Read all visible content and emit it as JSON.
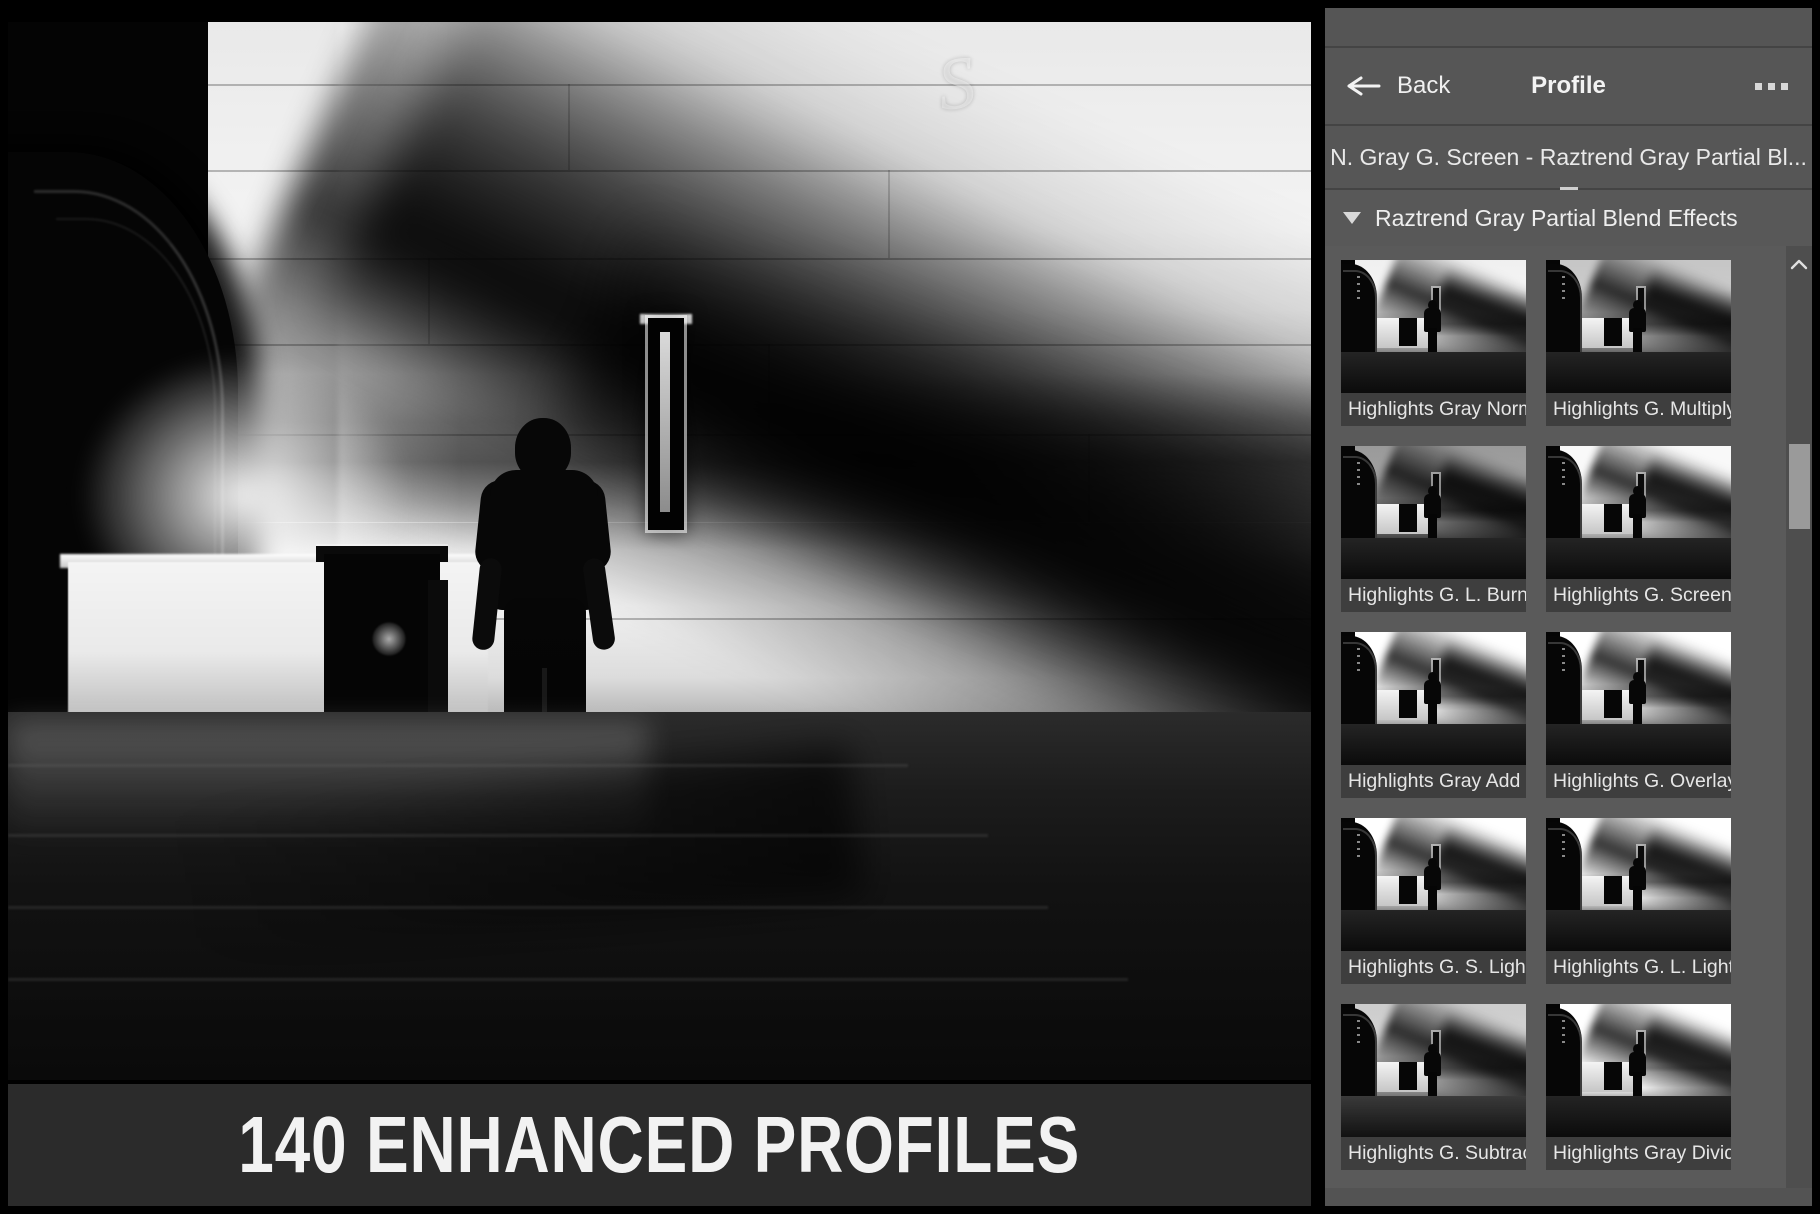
{
  "banner": {
    "text": "140 ENHANCED PROFILES"
  },
  "photo": {
    "alt": "Black and white photograph of a man walking through a stone passageway with strong diagonal shadows",
    "script_mark": "S"
  },
  "panel": {
    "header": {
      "back_label": "Back",
      "title": "Profile",
      "back_icon": "arrow-left-icon",
      "overflow_icon": "ellipsis-icon"
    },
    "current_profile": "N. Gray G. Screen - Raztrend Gray Partial Bl...",
    "group": {
      "label": "Raztrend Gray Partial Blend Effects",
      "caret_icon": "caret-down-icon",
      "expanded": true
    },
    "scrollbar": {
      "up_icon": "chevron-up-icon",
      "thumb_top_pct": 21,
      "thumb_height_pct": 9
    },
    "thumbnails": [
      {
        "label": "Highlights Gray Normal",
        "variant": "v-normal"
      },
      {
        "label": "Highlights G. Multiply",
        "variant": "v-multiply"
      },
      {
        "label": "Highlights G. L. Burn",
        "variant": "v-lburn"
      },
      {
        "label": "Highlights G. Screen",
        "variant": "v-screen"
      },
      {
        "label": "Highlights Gray Add",
        "variant": "v-add"
      },
      {
        "label": "Highlights G. Overlay",
        "variant": "v-overlay"
      },
      {
        "label": "Highlights G. S. Light",
        "variant": "v-slight"
      },
      {
        "label": "Highlights G. L. Light",
        "variant": "v-llight"
      },
      {
        "label": "Highlights G. Subtract",
        "variant": "v-subtract"
      },
      {
        "label": "Highlights Gray Divide",
        "variant": "v-divide"
      }
    ]
  },
  "colors": {
    "panel_bg": "#535353",
    "grid_bg": "#5a5a5a",
    "caption_bg": "#3e3e3e",
    "banner_bg": "#2b2b2b",
    "text": "#eeeeee",
    "scroll_thumb": "#9a9a9a",
    "frame": "#000000"
  }
}
